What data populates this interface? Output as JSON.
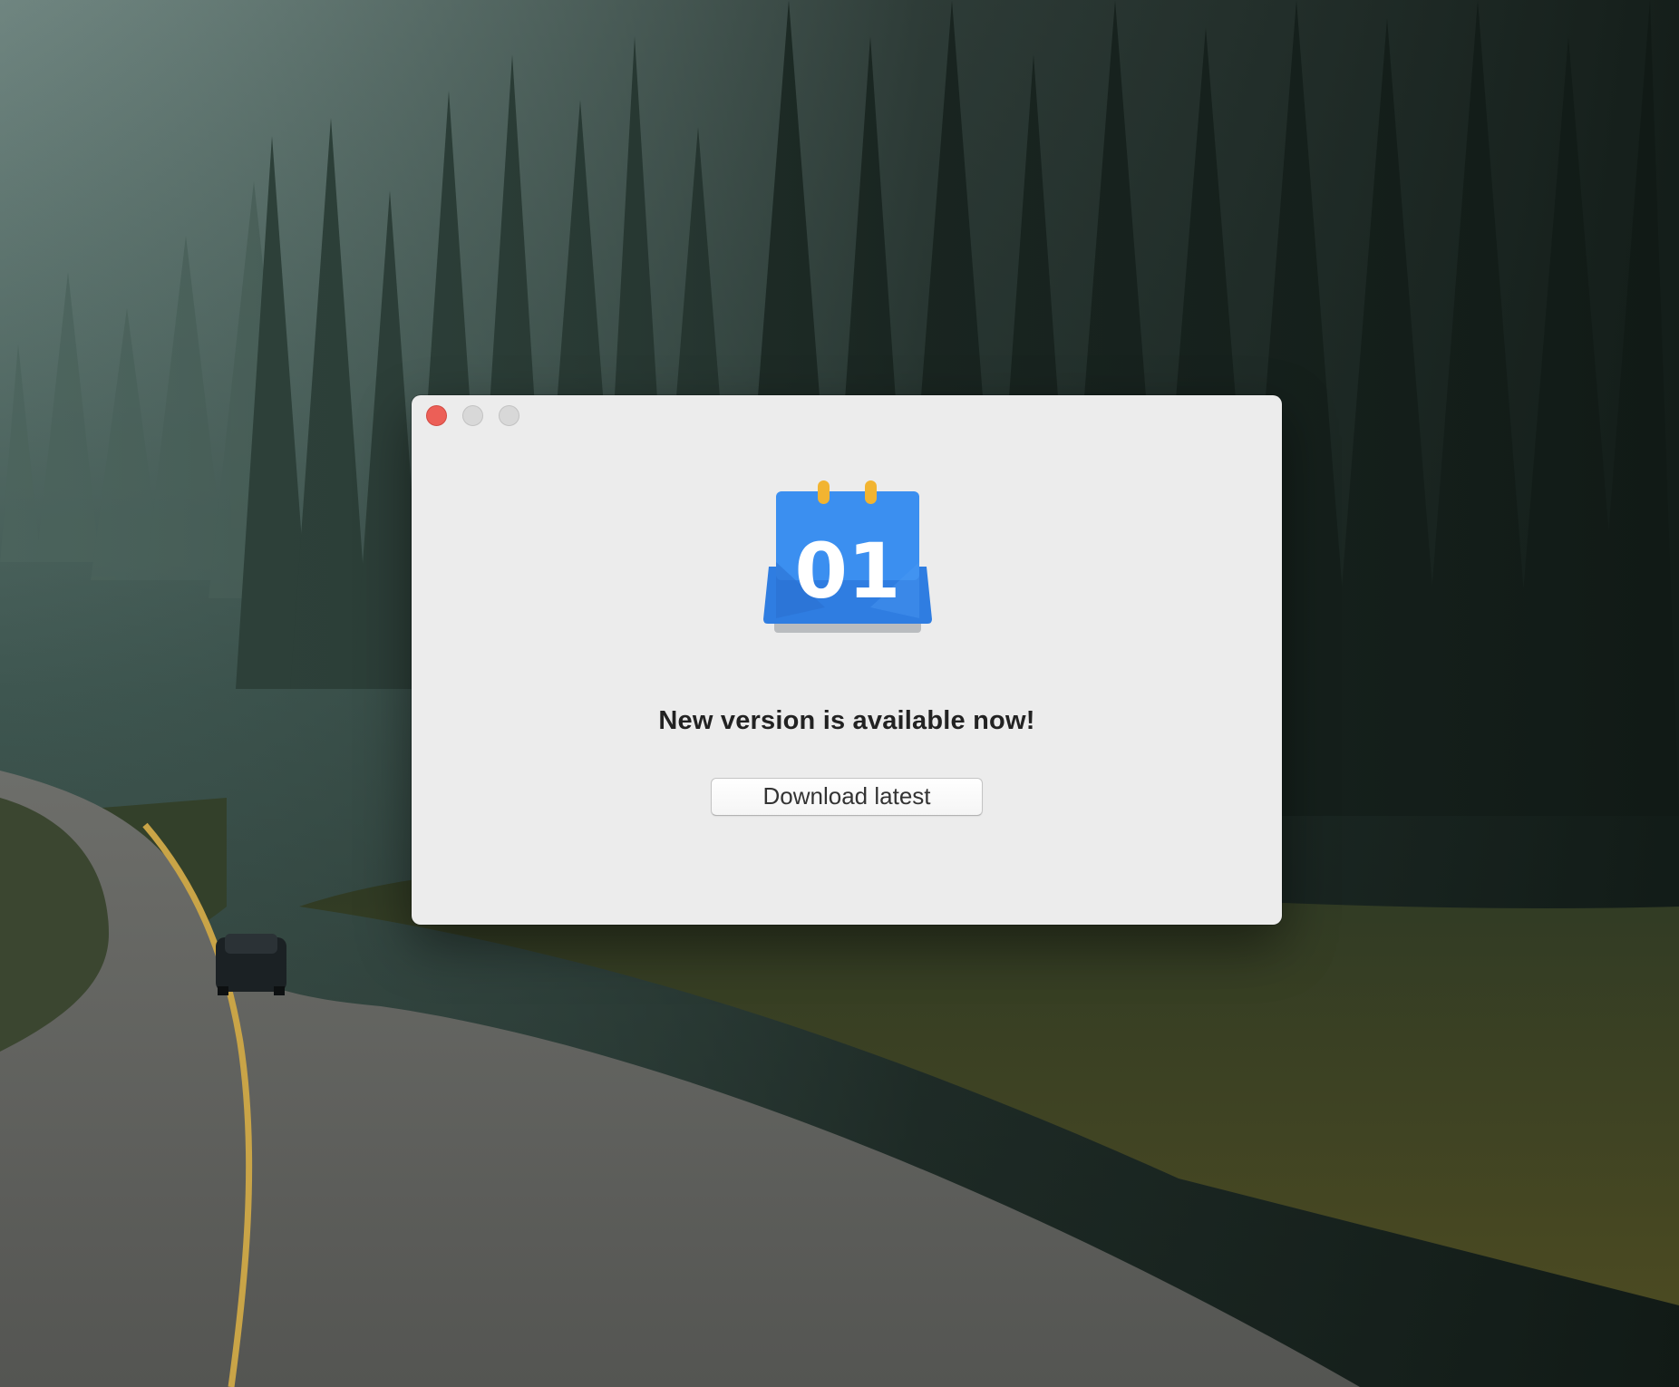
{
  "desktop": {
    "wallpaper": "forest-road-wallpaper"
  },
  "window": {
    "controls": {
      "close": "close-icon",
      "minimize": "minimize-icon",
      "zoom": "zoom-icon"
    },
    "app_icon": {
      "name": "calendar-icon",
      "day_text": "01",
      "color": "#2f7de1"
    },
    "headline": "New version is available now!",
    "download_button_label": "Download latest"
  }
}
